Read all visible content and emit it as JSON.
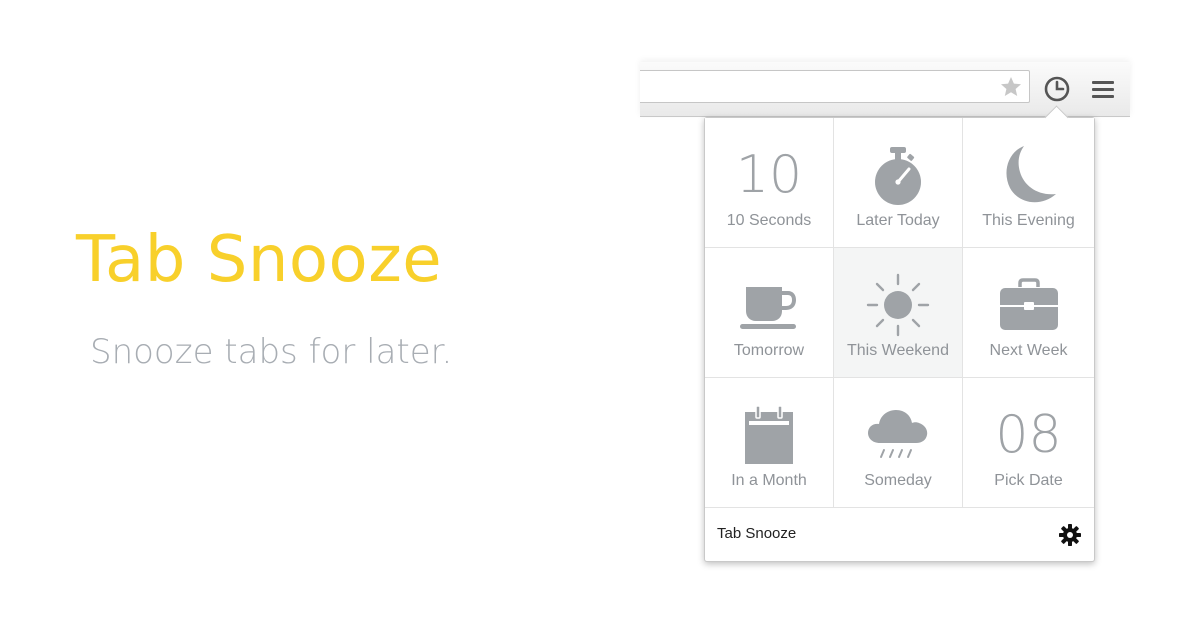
{
  "hero": {
    "title": "Tab Snooze",
    "subtitle": "Snooze tabs for later.",
    "title_color": "#f8d02b",
    "subtitle_color": "#a8adb3"
  },
  "toolbar": {
    "icons": [
      "star-icon",
      "snooze-clock-icon",
      "hamburger-menu-icon"
    ]
  },
  "popup": {
    "options": [
      {
        "label": "10 Seconds",
        "icon": "number-10",
        "icon_text": "10"
      },
      {
        "label": "Later Today",
        "icon": "stopwatch-icon"
      },
      {
        "label": "This Evening",
        "icon": "moon-icon"
      },
      {
        "label": "Tomorrow",
        "icon": "coffee-cup-icon"
      },
      {
        "label": "This Weekend",
        "icon": "sun-icon",
        "highlighted": true
      },
      {
        "label": "Next Week",
        "icon": "briefcase-icon"
      },
      {
        "label": "In a Month",
        "icon": "calendar-icon"
      },
      {
        "label": "Someday",
        "icon": "rain-cloud-icon"
      },
      {
        "label": "Pick Date",
        "icon": "number-08",
        "icon_text": "08"
      }
    ],
    "footer_title": "Tab Snooze",
    "icon_color": "#9fa3a7"
  }
}
